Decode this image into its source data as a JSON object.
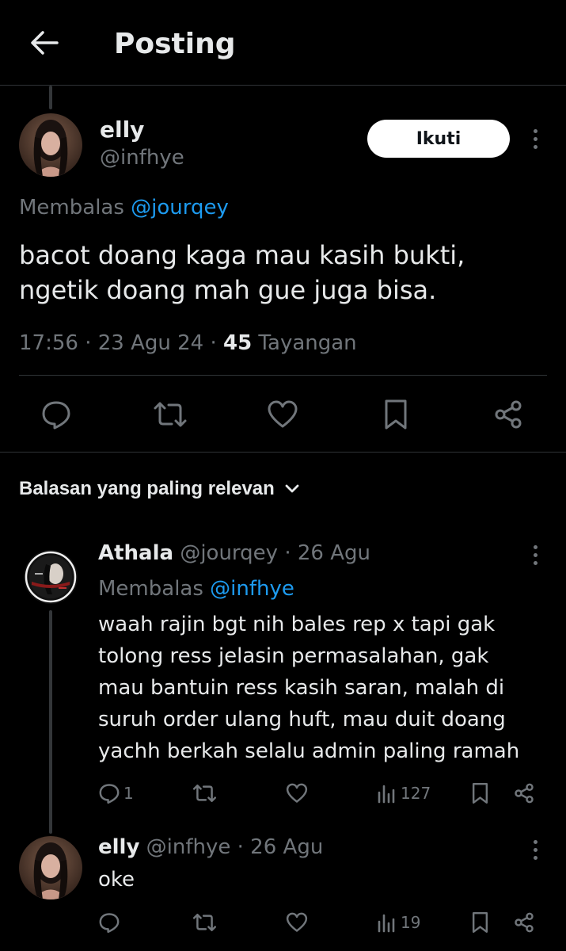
{
  "header": {
    "title": "Posting",
    "back_icon": "arrow-left-icon"
  },
  "main_post": {
    "name": "elly",
    "handle": "@infhye",
    "follow_label": "Ikuti",
    "replying_prefix": "Membalas",
    "replying_to": "@jourqey",
    "text_line1": "bacot doang kaga mau kasih bukti,",
    "text_line2": "ngetik doang mah gue juga bisa.",
    "timestamp": "17:56 · 23 Agu 24 · ",
    "views_count": "45",
    "views_label": " Tayangan",
    "actions": [
      "reply-icon",
      "repost-icon",
      "like-icon",
      "bookmark-icon",
      "share-icon"
    ]
  },
  "sort": {
    "label": "Balasan yang paling relevan"
  },
  "replies": [
    {
      "name": "Athala",
      "meta": " @jourqey · 26 Agu",
      "replying_prefix": "Membalas",
      "replying_to": "@infhye",
      "lines": [
        "waah rajin bgt nih bales rep x tapi gak",
        "tolong ress jelasin permasalahan, gak",
        "mau bantuin ress kasih saran, malah di",
        "suruh order ulang huft, mau duit doang",
        "yachh berkah selalu admin paling ramah"
      ],
      "reply_count": "1",
      "views": "127"
    },
    {
      "name": "elly",
      "meta": " @infhye · 26 Agu",
      "lines": [
        "oke"
      ],
      "views": "19"
    }
  ],
  "colors": {
    "background": "#000000",
    "text": "#e7e9ea",
    "muted": "#71767b",
    "accent": "#1d9bf0",
    "divider": "#2f3336"
  }
}
